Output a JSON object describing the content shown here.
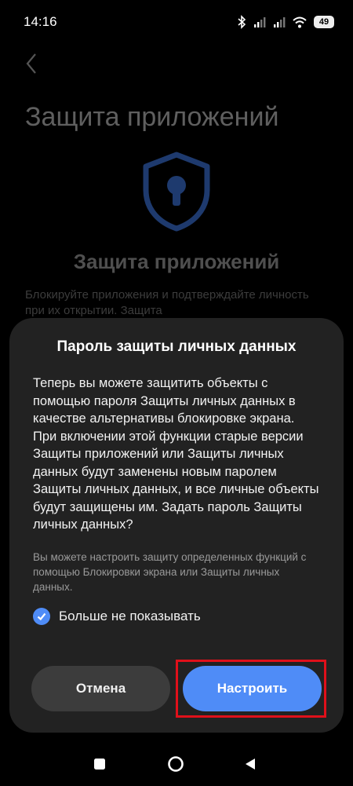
{
  "status_bar": {
    "time": "14:16",
    "battery": "49",
    "icons": [
      "bluetooth-icon",
      "signal-icon",
      "signal-icon",
      "wifi-icon",
      "battery-icon"
    ]
  },
  "background": {
    "title": "Защита приложений",
    "subtitle": "Защита приложений",
    "description": "Блокируйте приложения и подтверждайте личность при их открытии. Защита"
  },
  "dialog": {
    "title": "Пароль защиты личных данных",
    "body": "Теперь вы можете защитить объекты с помощью пароля Защиты личных данных в качестве альтернативы блокировке экрана. При включении этой функции старые версии Защиты приложений или Защиты личных данных будут заменены новым паролем Защиты личных данных, и все личные объекты будут защищены им. Задать пароль Защиты личных данных?",
    "note": "Вы можете настроить защиту определенных функций с помощью Блокировки экрана или Защиты личных данных.",
    "checkbox_label": "Больше не показывать",
    "checkbox_checked": true,
    "cancel_label": "Отмена",
    "setup_label": "Настроить"
  },
  "colors": {
    "accent": "#4f8cf7",
    "dialog_bg": "#222222",
    "highlight": "#e0101a"
  }
}
